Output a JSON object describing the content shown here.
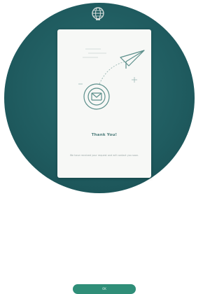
{
  "dialog": {
    "title": "Thank You!",
    "message": "We have received your request and will contact you soon.",
    "button_label": "OK"
  },
  "colors": {
    "background_circle": "#1f5b5f",
    "card": "#f7f8f6",
    "accent": "#2f8e78",
    "illustration_stroke": "#5c8f8b"
  },
  "icons": {
    "top_logo": "globe-icon",
    "illustration_primary": "paper-plane-icon",
    "illustration_secondary": "envelope-icon"
  }
}
